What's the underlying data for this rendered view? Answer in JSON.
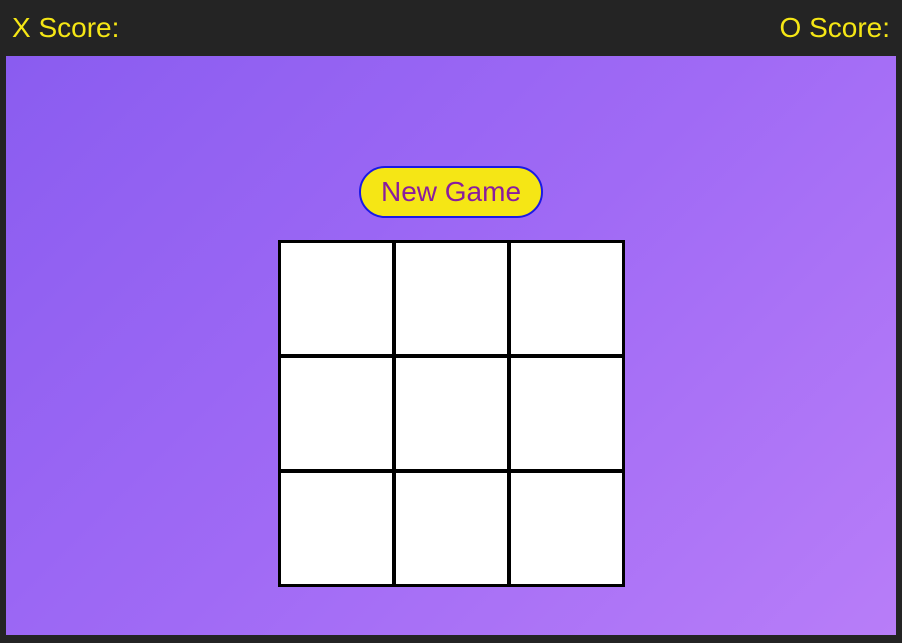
{
  "header": {
    "x_score_label": "X Score:",
    "o_score_label": "O Score:"
  },
  "controls": {
    "new_game_label": "New Game"
  },
  "board": {
    "cells": [
      "",
      "",
      "",
      "",
      "",
      "",
      "",
      "",
      ""
    ]
  }
}
